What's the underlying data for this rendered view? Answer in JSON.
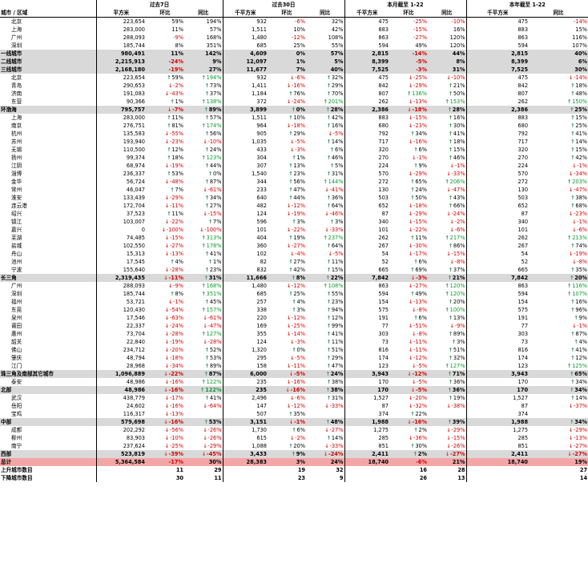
{
  "header": {
    "col_city": "城市 / 区域",
    "groups": [
      "过去7日",
      "过去30日",
      "本月截至 1-22",
      "本年截至 1-22"
    ],
    "unit_sqm": "平方米",
    "unit_ksqm": "千平方米",
    "huanbi": "环比",
    "tongbi": "同比"
  },
  "rows": [
    {
      "t": "c",
      "n": "北京",
      "c": [
        "223,654",
        "59%",
        "194%",
        "932",
        "-6%",
        "32%",
        "475",
        "-25%",
        "-10%",
        "475",
        "-14%"
      ]
    },
    {
      "t": "c",
      "n": "上海",
      "c": [
        "283,000",
        "11%",
        "57%",
        "1,511",
        "10%",
        "42%",
        "883",
        "-15%",
        "16%",
        "883",
        "15%"
      ]
    },
    {
      "t": "c",
      "n": "广州",
      "c": [
        "288,093",
        "-9%",
        "168%",
        "1,480",
        "-12%",
        "108%",
        "863",
        "-27%",
        "120%",
        "863",
        "116%"
      ]
    },
    {
      "t": "c",
      "n": "深圳",
      "c": [
        "185,744",
        "8%",
        "351%",
        "685",
        "25%",
        "55%",
        "594",
        "49%",
        "120%",
        "594",
        "107%"
      ]
    },
    {
      "t": "s",
      "n": "一线城市",
      "c": [
        "980,491",
        "11%",
        "142%",
        "4,609",
        "0%",
        "57%",
        "2,815",
        "-14%",
        "44%",
        "2,815",
        "40%"
      ]
    },
    {
      "t": "s",
      "n": "二线城市",
      "c": [
        "2,215,913",
        "-24%",
        "9%",
        "12,097",
        "1%",
        "5%",
        "8,399",
        "-5%",
        "8%",
        "8,399",
        "6%"
      ]
    },
    {
      "t": "s",
      "n": "三线城市",
      "c": [
        "2,168,180",
        "-19%",
        "27%",
        "11,677",
        "7%",
        "40%",
        "7,525",
        "-3%",
        "31%",
        "7,525",
        "30%"
      ]
    },
    {
      "t": "c",
      "n": "北京",
      "c": [
        "223,654",
        "u59%",
        "u194%",
        "932",
        "d-6%",
        "u32%",
        "475",
        "d-25%",
        "d-10%",
        "475",
        "d-14%"
      ]
    },
    {
      "t": "c",
      "n": "青岛",
      "c": [
        "290,653",
        "d-2%",
        "u73%",
        "1,411",
        "d-16%",
        "u29%",
        "842",
        "d-29%",
        "u21%",
        "842",
        "u18%"
      ]
    },
    {
      "t": "c",
      "n": "济南",
      "c": [
        "191,083",
        "d-43%",
        "u37%",
        "1,184",
        "u76%",
        "u70%",
        "807",
        "u136%",
        "u50%",
        "807",
        "u48%"
      ]
    },
    {
      "t": "c",
      "n": "东营",
      "c": [
        "90,366",
        "u1%",
        "u138%",
        "372",
        "d-24%",
        "u201%",
        "262",
        "d-13%",
        "u153%",
        "262",
        "u150%"
      ]
    },
    {
      "t": "s",
      "n": "环渤海",
      "c": [
        "795,757",
        "d-7%",
        "u89%",
        "3,899",
        "u0%",
        "u28%",
        "2,386",
        "d-18%",
        "u28%",
        "2,386",
        "u25%"
      ]
    },
    {
      "t": "c",
      "n": "上海",
      "c": [
        "283,000",
        "u11%",
        "u57%",
        "1,511",
        "u10%",
        "u42%",
        "883",
        "d-15%",
        "u16%",
        "883",
        "u15%"
      ]
    },
    {
      "t": "c",
      "n": "南京",
      "c": [
        "276,751",
        "u81%",
        "u174%",
        "964",
        "d-18%",
        "u16%",
        "680",
        "d-23%",
        "u30%",
        "680",
        "u25%"
      ]
    },
    {
      "t": "c",
      "n": "杭州",
      "c": [
        "135,583",
        "d-55%",
        "u56%",
        "905",
        "u29%",
        "d-5%",
        "792",
        "u34%",
        "u41%",
        "792",
        "u41%"
      ]
    },
    {
      "t": "c",
      "n": "苏州",
      "c": [
        "193,940",
        "d-23%",
        "d-10%",
        "1,035",
        "d-5%",
        "u14%",
        "717",
        "d-16%",
        "u18%",
        "717",
        "u14%"
      ]
    },
    {
      "t": "c",
      "n": "无锡",
      "c": [
        "110,500",
        "u12%",
        "u24%",
        "433",
        "d-3%",
        "u6%",
        "320",
        "u6%",
        "u15%",
        "320",
        "u15%"
      ]
    },
    {
      "t": "c",
      "n": "扬州",
      "c": [
        "99,374",
        "u18%",
        "u123%",
        "304",
        "u1%",
        "u46%",
        "270",
        "d-1%",
        "u46%",
        "270",
        "u42%"
      ]
    },
    {
      "t": "c",
      "n": "江阴",
      "c": [
        "68,974",
        "d-19%",
        "u44%",
        "307",
        "u13%",
        "u5%",
        "224",
        "u9%",
        "d-1%",
        "224",
        "d-1%"
      ]
    },
    {
      "t": "c",
      "n": "淄博",
      "c": [
        "236,337",
        "u53%",
        "u0%",
        "1,540",
        "u23%",
        "u31%",
        "570",
        "d-29%",
        "d-33%",
        "570",
        "d-34%"
      ]
    },
    {
      "t": "c",
      "n": "金华",
      "c": [
        "56,724",
        "d-48%",
        "u87%",
        "344",
        "u56%",
        "u144%",
        "272",
        "u65%",
        "u206%",
        "272",
        "u203%"
      ]
    },
    {
      "t": "c",
      "n": "常州",
      "c": [
        "46,047",
        "u7%",
        "d-61%",
        "233",
        "u47%",
        "d-41%",
        "130",
        "u24%",
        "d-47%",
        "130",
        "d-47%"
      ]
    },
    {
      "t": "c",
      "n": "淮安",
      "c": [
        "133,439",
        "d-29%",
        "u34%",
        "640",
        "u44%",
        "u36%",
        "503",
        "u50%",
        "u43%",
        "503",
        "u38%"
      ]
    },
    {
      "t": "c",
      "n": "连云港",
      "c": [
        "172,704",
        "d-11%",
        "u27%",
        "482",
        "d-12%",
        "u64%",
        "652",
        "d-18%",
        "u66%",
        "652",
        "u68%"
      ]
    },
    {
      "t": "c",
      "n": "绍兴",
      "c": [
        "37,523",
        "u11%",
        "d-15%",
        "124",
        "d-19%",
        "d-46%",
        "87",
        "d-29%",
        "d-24%",
        "87",
        "d-23%"
      ]
    },
    {
      "t": "c",
      "n": "镇江",
      "c": [
        "103,007",
        "d-22%",
        "u7%",
        "596",
        "u3%",
        "u3%",
        "340",
        "d-15%",
        "d-2%",
        "340",
        "d-1%"
      ]
    },
    {
      "t": "c",
      "n": "嘉兴",
      "c": [
        "0",
        "d-100%",
        "d-100%",
        "101",
        "d-22%",
        "d-33%",
        "101",
        "d-22%",
        "d-6%",
        "101",
        "d-6%"
      ]
    },
    {
      "t": "c",
      "n": "芜湖",
      "c": [
        "74,485",
        "d-15%",
        "u313%",
        "404",
        "u19%",
        "u237%",
        "262",
        "u11%",
        "u217%",
        "262",
        "u213%"
      ]
    },
    {
      "t": "c",
      "n": "盐城",
      "c": [
        "102,550",
        "d-27%",
        "u178%",
        "360",
        "d-27%",
        "u64%",
        "267",
        "d-30%",
        "u86%",
        "267",
        "u74%"
      ]
    },
    {
      "t": "c",
      "n": "舟山",
      "c": [
        "15,313",
        "d-13%",
        "u41%",
        "102",
        "d-4%",
        "d-5%",
        "54",
        "d-17%",
        "d-15%",
        "54",
        "d-19%"
      ]
    },
    {
      "t": "c",
      "n": "池州",
      "c": [
        "17,545",
        "u4%",
        "u1%",
        "82",
        "u27%",
        "u11%",
        "52",
        "u6%",
        "d-8%",
        "52",
        "d-8%"
      ]
    },
    {
      "t": "c",
      "n": "宁波",
      "c": [
        "155,640",
        "d-28%",
        "u23%",
        "832",
        "u42%",
        "u15%",
        "665",
        "u69%",
        "u37%",
        "665",
        "u35%"
      ]
    },
    {
      "t": "s",
      "n": "长三角",
      "c": [
        "2,319,435",
        "d-11%",
        "u31%",
        "11,666",
        "u8%",
        "u22%",
        "7,842",
        "d-3%",
        "u21%",
        "7,842",
        "u20%"
      ]
    },
    {
      "t": "c",
      "n": "广州",
      "c": [
        "288,093",
        "d-9%",
        "u168%",
        "1,480",
        "d-12%",
        "u108%",
        "863",
        "d-27%",
        "u120%",
        "863",
        "u116%"
      ]
    },
    {
      "t": "c",
      "n": "深圳",
      "c": [
        "185,744",
        "u8%",
        "u351%",
        "685",
        "u25%",
        "u55%",
        "594",
        "u49%",
        "u120%",
        "594",
        "u107%"
      ]
    },
    {
      "t": "c",
      "n": "福州",
      "c": [
        "53,721",
        "d-1%",
        "u45%",
        "257",
        "u4%",
        "u23%",
        "154",
        "d-13%",
        "u20%",
        "154",
        "u16%"
      ]
    },
    {
      "t": "c",
      "n": "东莞",
      "c": [
        "120,430",
        "d-54%",
        "u157%",
        "338",
        "u3%",
        "u94%",
        "575",
        "d-8%",
        "u100%",
        "575",
        "u96%"
      ]
    },
    {
      "t": "c",
      "n": "泉州",
      "c": [
        "17,546",
        "d-63%",
        "d-61%",
        "220",
        "d-12%",
        "u12%",
        "191",
        "u6%",
        "u13%",
        "191",
        "u9%"
      ]
    },
    {
      "t": "c",
      "n": "莆田",
      "c": [
        "22,337",
        "d-24%",
        "d-47%",
        "169",
        "d-25%",
        "u99%",
        "77",
        "d-51%",
        "d-9%",
        "77",
        "d-1%"
      ]
    },
    {
      "t": "c",
      "n": "惠州",
      "c": [
        "73,704",
        "d-28%",
        "u127%",
        "355",
        "d-14%",
        "u41%",
        "303",
        "d-8%",
        "u89%",
        "303",
        "u87%"
      ]
    },
    {
      "t": "c",
      "n": "韶关",
      "c": [
        "22,840",
        "d-19%",
        "d-28%",
        "124",
        "d-3%",
        "u11%",
        "73",
        "d-11%",
        "u3%",
        "73",
        "u4%"
      ]
    },
    {
      "t": "c",
      "n": "佛山",
      "c": [
        "234,712",
        "d-20%",
        "u52%",
        "1,320",
        "u0%",
        "u51%",
        "816",
        "d-11%",
        "u51%",
        "816",
        "u41%"
      ]
    },
    {
      "t": "c",
      "n": "肇庆",
      "c": [
        "48,794",
        "d-18%",
        "u53%",
        "295",
        "d-5%",
        "u29%",
        "174",
        "d-12%",
        "u32%",
        "174",
        "u12%"
      ]
    },
    {
      "t": "c",
      "n": "江门",
      "c": [
        "28,968",
        "d-34%",
        "u89%",
        "158",
        "d-11%",
        "u47%",
        "123",
        "d-5%",
        "u127%",
        "123",
        "u125%"
      ]
    },
    {
      "t": "s",
      "n": "珠三角及南部其它城市",
      "c": [
        "1,096,889",
        "d-22%",
        "u87%",
        "6,000",
        "d-5%",
        "u24%",
        "3,943",
        "d-12%",
        "u71%",
        "3,943",
        "u65%"
      ]
    },
    {
      "t": "c",
      "n": "泰安",
      "c": [
        "48,986",
        "d-16%",
        "u122%",
        "235",
        "d-16%",
        "u38%",
        "170",
        "d-5%",
        "u36%",
        "170",
        "u34%"
      ]
    },
    {
      "t": "s",
      "n": "北部",
      "c": [
        "48,986",
        "d-16%",
        "u122%",
        "235",
        "d-16%",
        "u38%",
        "170",
        "d-5%",
        "u36%",
        "170",
        "u34%"
      ]
    },
    {
      "t": "c",
      "n": "武汉",
      "c": [
        "438,779",
        "d-17%",
        "u41%",
        "2,496",
        "d-6%",
        "u31%",
        "1,527",
        "d-20%",
        "u19%",
        "1,527",
        "u14%"
      ]
    },
    {
      "t": "c",
      "n": "岳阳",
      "c": [
        "24,602",
        "d-16%",
        "d-64%",
        "147",
        "d-12%",
        "d-33%",
        "87",
        "d-32%",
        "d-38%",
        "87",
        "d-37%"
      ]
    },
    {
      "t": "c",
      "n": "宝鸡",
      "c": [
        "116,317",
        "d-13%",
        "",
        "507",
        "u35%",
        "",
        "374",
        "u22%",
        "",
        "374",
        ""
      ]
    },
    {
      "t": "s",
      "n": "中部",
      "c": [
        "579,698",
        "d-16%",
        "u53%",
        "3,151",
        "d-1%",
        "u48%",
        "1,988",
        "d-16%",
        "u39%",
        "1,988",
        "u34%"
      ]
    },
    {
      "t": "c",
      "n": "成都",
      "c": [
        "202,292",
        "d-56%",
        "d-26%",
        "1,730",
        "u6%",
        "d-27%",
        "1,275",
        "u2%",
        "d-29%",
        "1,275",
        "d-29%"
      ]
    },
    {
      "t": "c",
      "n": "柳州",
      "c": [
        "83,903",
        "d-10%",
        "d-26%",
        "615",
        "d-2%",
        "u14%",
        "285",
        "d-36%",
        "d-15%",
        "285",
        "d-13%"
      ]
    },
    {
      "t": "c",
      "n": "南宁",
      "c": [
        "237,624",
        "d-25%",
        "d-29%",
        "1,088",
        "u20%",
        "d-33%",
        "851",
        "u30%",
        "d-26%",
        "851",
        "d-27%"
      ]
    },
    {
      "t": "s",
      "n": "西部",
      "c": [
        "523,819",
        "d-39%",
        "d-45%",
        "3,433",
        "u9%",
        "d-24%",
        "2,411",
        "u2%",
        "d-27%",
        "2,411",
        "d-27%"
      ]
    },
    {
      "t": "t",
      "n": "总计",
      "c": [
        "5,364,584",
        "-17%",
        "30%",
        "28,383",
        "3%",
        "24%",
        "18,740",
        "-6%",
        "21%",
        "18,740",
        "19%"
      ]
    },
    {
      "t": "n",
      "n": "上升城市数目",
      "c": [
        "",
        "11",
        "29",
        "",
        "19",
        "32",
        "",
        "16",
        "28",
        "",
        "27"
      ]
    },
    {
      "t": "n",
      "n": "下降城市数目",
      "c": [
        "",
        "30",
        "11",
        "",
        "23",
        "9",
        "",
        "26",
        "13",
        "",
        "14"
      ]
    }
  ],
  "icons": {
    "up": "arrow-up-icon",
    "down": "arrow-down-icon"
  },
  "colors": {
    "subtotal_bg": "#d9d9d9",
    "total_bg": "#f4a6a6",
    "neg": "#d40000",
    "pos_big": "#0a9a2a"
  }
}
